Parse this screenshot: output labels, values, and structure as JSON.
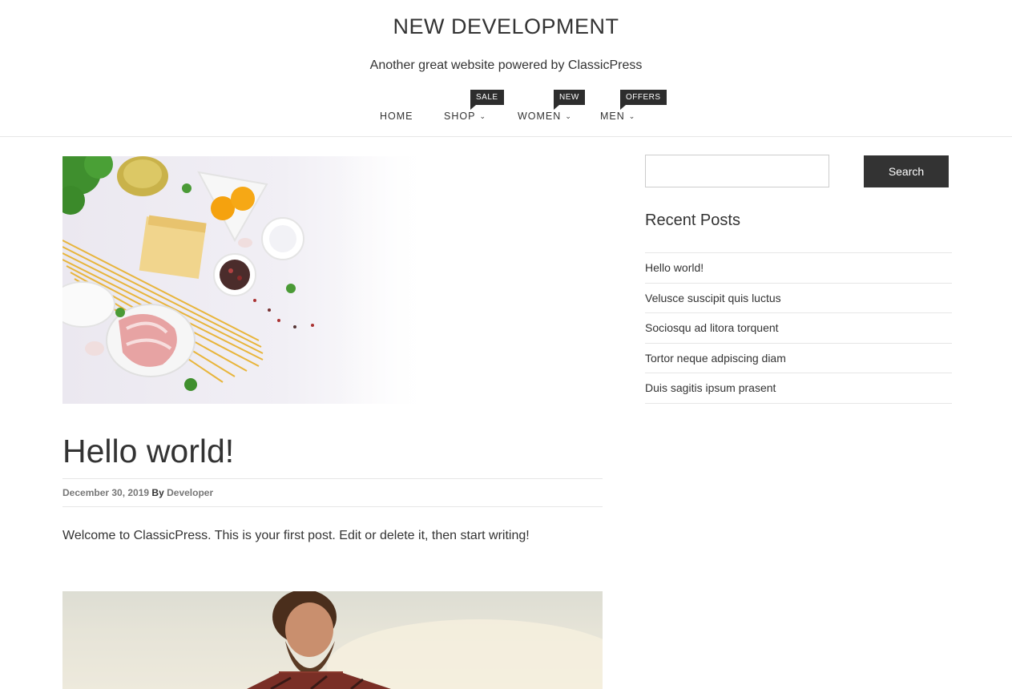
{
  "header": {
    "site_title": "NEW DEVELOPMENT",
    "tagline": "Another great website powered by ClassicPress"
  },
  "nav": {
    "items": [
      {
        "label": "HOME",
        "badge": null,
        "has_dropdown": false
      },
      {
        "label": "SHOP",
        "badge": "SALE",
        "has_dropdown": true
      },
      {
        "label": "WOMEN",
        "badge": "NEW",
        "has_dropdown": true
      },
      {
        "label": "MEN",
        "badge": "OFFERS",
        "has_dropdown": true
      }
    ],
    "dropdown_glyph": "⌄"
  },
  "posts": [
    {
      "title": "Hello world!",
      "date": "December 30, 2019",
      "by_label": "By",
      "author": "Developer",
      "excerpt": "Welcome to ClassicPress. This is your first post. Edit or delete it, then start writing!",
      "thumbnail_icon": "pasta-ingredients-image"
    },
    {
      "thumbnail_icon": "bearded-man-image"
    }
  ],
  "sidebar": {
    "search": {
      "placeholder": "",
      "button_label": "Search"
    },
    "recent_posts": {
      "title": "Recent Posts",
      "items": [
        "Hello world!",
        "Velusce suscipit quis luctus",
        "Sociosqu ad litora torquent",
        "Tortor neque adpiscing diam",
        "Duis sagitis ipsum prasent"
      ]
    }
  },
  "colors": {
    "text": "#333333",
    "badge_bg": "#2d2d2d",
    "button_bg": "#333333",
    "divider": "#e6e6e6"
  }
}
